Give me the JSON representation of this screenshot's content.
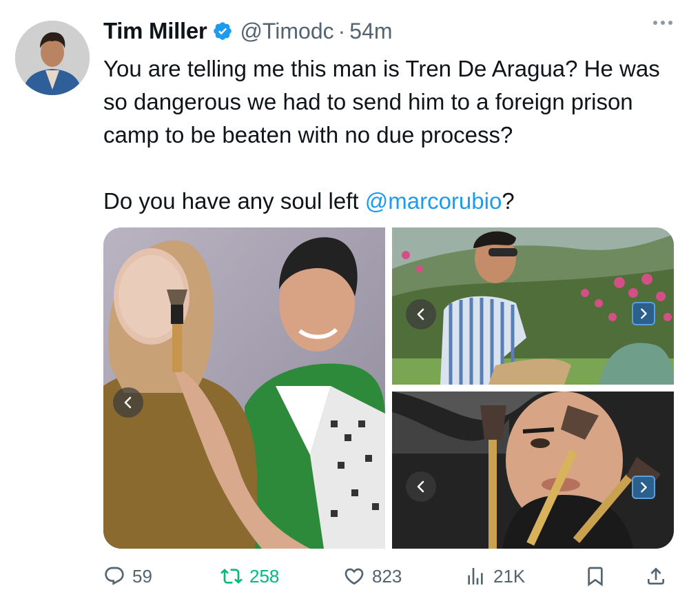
{
  "author": {
    "name": "Tim Miller",
    "handle": "@Timodc",
    "separator": "·",
    "time": "54m"
  },
  "tweet": {
    "line1": "You are telling me this man is Tren De Aragua? He was so dangerous we had to send him to a foreign prison camp to be beaten with no due process?",
    "line2_before": "Do you have any soul left ",
    "line2_mention": "@marcorubio",
    "line2_after": "?"
  },
  "metrics": {
    "replies": "59",
    "reposts": "258",
    "likes": "823",
    "views": "21K"
  },
  "colors": {
    "accent": "#1d9bf0",
    "repost_active": "#00ba7c",
    "muted": "#536471"
  },
  "icons": [
    "verified-badge-icon",
    "more-icon",
    "reply-icon",
    "repost-icon",
    "like-icon",
    "views-icon",
    "bookmark-icon",
    "share-icon",
    "chevron-left-icon",
    "chevron-right-icon"
  ]
}
